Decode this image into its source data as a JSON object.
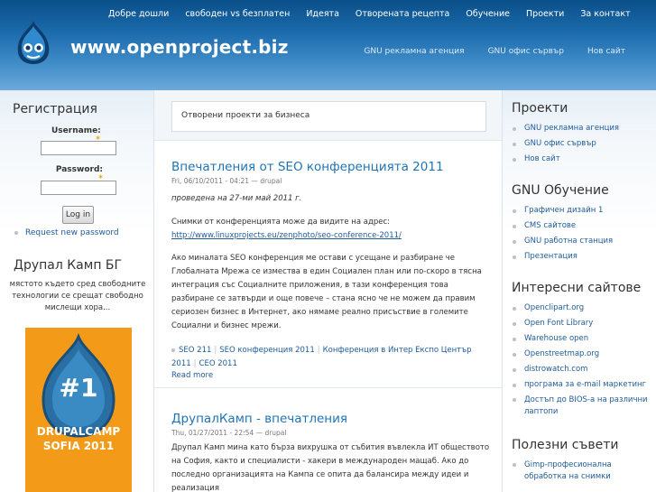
{
  "header": {
    "site_name": "www.openproject.biz",
    "primary_nav": [
      "Добре дошли",
      "свободен vs безплатен",
      "Идеята",
      "Отворената рецепта",
      "Обучение",
      "Проекти",
      "За контакт"
    ],
    "secondary_nav": [
      "GNU рекламна агенция",
      "GNU офис сървър",
      "Нов сайт"
    ]
  },
  "login": {
    "title": "Регистрация",
    "username_label": "Username:",
    "password_label": "Password:",
    "required_mark": "*",
    "button": "Log in",
    "request_password": "Request new password"
  },
  "camp": {
    "title": "Друпал Камп БГ",
    "text": "мястото където сред свободните технологии се срещат свободно мислещи хора...",
    "banner_number": "#1",
    "banner_line1": "DRUPALCAMP",
    "banner_line2": "SOFIA 2011"
  },
  "mission": "Отворени проекти за бизнеса",
  "nodes": [
    {
      "title": "Впечатления от SEO конференцията 2011",
      "meta": "Fri, 06/10/2011 - 04:21 — drupal",
      "lead": "проведена на 27-ми май 2011 г.",
      "para1": "Снимки от конференцията може да видите на адрес:",
      "link": "http://www.linuxprojects.eu/zenphoto/seo-conference-2011/",
      "para2": "Ако миналата SEO конференция ме остави с усещане и разбиране че Глобалната Мрежа се измества в един Социален план или по-скоро в тясна интеграция със Социалните приложения, в тази конференция това разбиране се затвърди и още повече – стана ясно че не можем да правим сериозен бизнес в Интернет, ако нямаме реално присъствие в големите Социални и бизнес мрежи.",
      "tags": [
        "SEO 211",
        "SEO конференция 2011",
        "Конференция в Интер Експо Център 2011",
        "СЕО 2011"
      ],
      "read_more": "Read more"
    },
    {
      "title": "ДрупалКамп - впечатления",
      "meta": "Thu, 01/27/2011 - 22:54 — drupal",
      "para1": "Друпал Камп мина като бърза вихрушка от събития въвлекла ИТ обществото на София, както и специалисти - хакери в международен мащаб. Ако до последно организацията на Кампа се опита да балансира между идеи и реализация"
    }
  ],
  "right": {
    "projects": {
      "title": "Проекти",
      "items": [
        "GNU рекламна агенция",
        "GNU офис сървър",
        "Нов сайт"
      ]
    },
    "training": {
      "title": "GNU Обучение",
      "items": [
        "Графичен дизайн 1",
        "CMS сайтове",
        "GNU работна станция",
        "Презентация"
      ]
    },
    "sites": {
      "title": "Интересни сайтове",
      "items": [
        "Openclipart.org",
        "Open Font Library",
        "Warehouse open",
        "Openstreetmap.org",
        "distrowatch.com",
        "програма за e-mail маркетинг",
        "Достъп до BIOS-а на различни лаптопи"
      ]
    },
    "tips": {
      "title": "Полезни съвети",
      "items": [
        "Gimp-професионална обработка на снимки"
      ]
    }
  },
  "colors": {
    "header_top": "#0a4f88",
    "header_bottom": "#6ea9d9",
    "link": "#1e5b99",
    "title_link": "#1f74b5",
    "banner": "#f39a18"
  }
}
